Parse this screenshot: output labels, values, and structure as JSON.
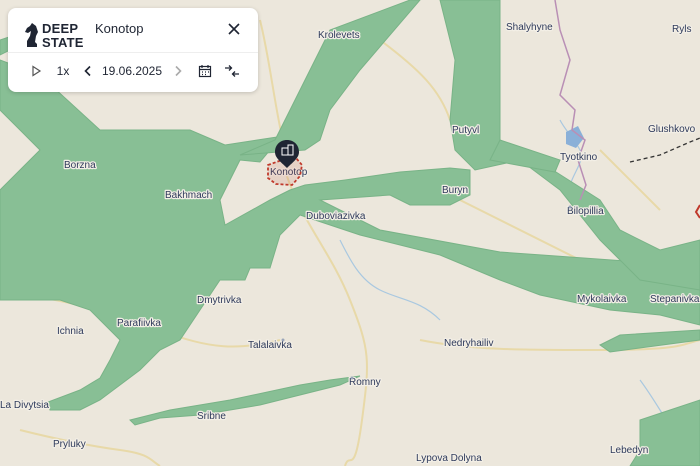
{
  "header": {
    "logo_line1": "DEEP",
    "logo_line2": "STATE",
    "title": "Konotop"
  },
  "toolbar": {
    "speed": "1x",
    "date": "19.06.2025"
  },
  "map": {
    "colors": {
      "land": "#ece7dc",
      "zone": "#88bf95",
      "zone_edge": "#79b387",
      "road": "#e8d9a8",
      "river": "#a9c8e0",
      "border": "#b98fb5",
      "marker": "#1f2533",
      "occupied": "#c0392b"
    },
    "marker_icon": "building-icon",
    "places": [
      {
        "name": "Krolevets",
        "id": "krolevets"
      },
      {
        "name": "Shalyhyne",
        "id": "shalyhyne"
      },
      {
        "name": "Ryls",
        "id": "ryls"
      },
      {
        "name": "Putyvl",
        "id": "putyvl"
      },
      {
        "name": "Glushkovo",
        "id": "glushkovo"
      },
      {
        "name": "Tyotkino",
        "id": "tyotkino"
      },
      {
        "name": "Borzna",
        "id": "borzna"
      },
      {
        "name": "Bakhmach",
        "id": "bakhmach"
      },
      {
        "name": "Konotop",
        "id": "konotop"
      },
      {
        "name": "Buryn",
        "id": "buryn"
      },
      {
        "name": "Dubovіazivka",
        "id": "dubovіazivka"
      },
      {
        "name": "Bilopillia",
        "id": "bilopillia"
      },
      {
        "name": "Dmytrivka",
        "id": "dmytrivka"
      },
      {
        "name": "Mykolaivka",
        "id": "mykolaivka"
      },
      {
        "name": "Stepanivka",
        "id": "stepanivka"
      },
      {
        "name": "Ichnia",
        "id": "ichnia"
      },
      {
        "name": "Parafiivka",
        "id": "parafiivka"
      },
      {
        "name": "Talalaivka",
        "id": "talalaivka"
      },
      {
        "name": "Nedryhailiv",
        "id": "nedryhailiv"
      },
      {
        "name": "Romny",
        "id": "romny"
      },
      {
        "name": "Lа Divytsia",
        "id": "divytsia"
      },
      {
        "name": "Sribne",
        "id": "sribne"
      },
      {
        "name": "Pryluky",
        "id": "pryluky"
      },
      {
        "name": "Lypova Dolyna",
        "id": "lypova"
      },
      {
        "name": "Lebedyn",
        "id": "lebedyn"
      }
    ]
  }
}
